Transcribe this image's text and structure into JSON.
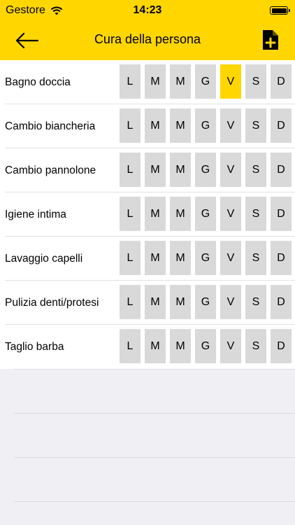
{
  "status": {
    "carrier": "Gestore",
    "time": "14:23"
  },
  "nav": {
    "title": "Cura della persona"
  },
  "days": [
    "L",
    "M",
    "M",
    "G",
    "V",
    "S",
    "D"
  ],
  "rows": [
    {
      "label": "Bagno doccia",
      "selected": [
        4
      ]
    },
    {
      "label": "Cambio biancheria",
      "selected": []
    },
    {
      "label": "Cambio pannolone",
      "selected": []
    },
    {
      "label": "Igiene intima",
      "selected": []
    },
    {
      "label": "Lavaggio capelli",
      "selected": []
    },
    {
      "label": "Pulizia denti/protesi",
      "selected": []
    },
    {
      "label": "Taglio barba",
      "selected": []
    }
  ],
  "colors": {
    "accent": "#ffd600",
    "day_bg": "#d9d9d9",
    "background": "#efeff4"
  },
  "icons": {
    "back": "arrow-left-icon",
    "add": "add-document-icon",
    "wifi": "wifi-icon",
    "battery": "battery-icon"
  }
}
